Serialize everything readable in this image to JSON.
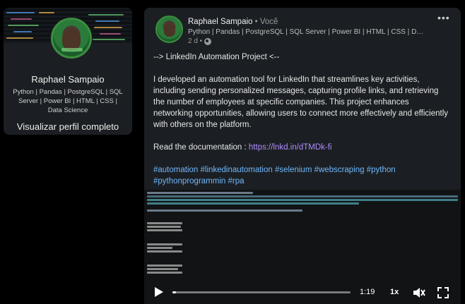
{
  "profile": {
    "name": "Raphael Sampaio",
    "headline": "Python | Pandas | PostgreSQL | SQL Server | Power BI | HTML | CSS | Data Science",
    "view_profile": "Visualizar perfil completo"
  },
  "post": {
    "author": "Raphael Sampaio",
    "author_suffix": " • Você",
    "headline": "Python | Pandas | PostgreSQL | SQL Server | Power BI | HTML | CSS | Data S...",
    "time": "2 d •",
    "more_icon": "more-horizontal-icon",
    "title": "--> LinkedIn Automation Project <--",
    "body": "I developed an automation tool for LinkedIn that streamlines key activities, including sending personalized messages, capturing profile links, and retrieving the number of employees at specific companies. This project enhances networking opportunities, allowing users to connect more effectively and efficiently with others on the platform.",
    "doc_prefix": "Read the documentation : ",
    "doc_link": "https://lnkd.in/dTMDk-fi",
    "hashtags": "#automation #linkedinautomation #selenium #webscraping #python #pythonprogrammin #rpa"
  },
  "video": {
    "time": "1:19",
    "speed": "1x",
    "progress": 0.02
  },
  "colors": {
    "background": "#000000",
    "card": "#1b1f23",
    "link": "#b18cff",
    "hashtag": "#71b7fb",
    "avatar_ring": "#3b8e3f"
  }
}
